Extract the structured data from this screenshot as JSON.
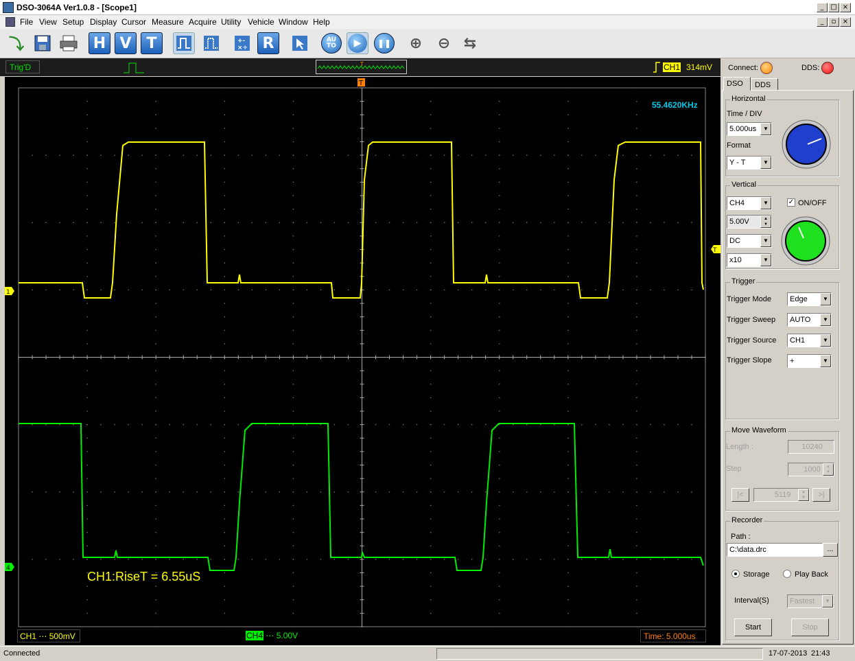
{
  "window": {
    "title": "DSO-3064A Ver1.0.8 - [Scope1]"
  },
  "menu": [
    "File",
    "View",
    "Setup",
    "Display",
    "Cursor",
    "Measure",
    "Acquire",
    "Utility",
    "Vehicle",
    "Window",
    "Help"
  ],
  "toolbar": {
    "h": "H",
    "v": "V",
    "t": "T",
    "r": "R",
    "auto": "AU TO"
  },
  "status": {
    "trig": "Trig'D",
    "trig_ch": "CH1",
    "trig_level": "314mV"
  },
  "scope": {
    "frequency": "55.4620KHz",
    "measurement": "CH1:RiseT = 6.55uS",
    "ch1_label": "CH1",
    "ch1_scale": "500mV",
    "ch4_label": "CH4",
    "ch4_scale": "5.00V",
    "time": "Time: 5.000us",
    "trigger_marker": "T",
    "ch1_marker": "1",
    "ch4_marker": "4",
    "ch1_color": "#ffff00",
    "ch4_color": "#00ee00"
  },
  "panel": {
    "connect": "Connect:",
    "dds": "DDS:",
    "tabs": [
      "DSO",
      "DDS"
    ],
    "horizontal": {
      "title": "Horizontal",
      "time_div_label": "Time / DIV",
      "time_div": "5.000us",
      "format_label": "Format",
      "format": "Y - T"
    },
    "vertical": {
      "title": "Vertical",
      "channel": "CH4",
      "onoff": "ON/OFF",
      "volts": "5.00V",
      "coupling": "DC",
      "probe": "x10"
    },
    "trigger": {
      "title": "Trigger",
      "mode_label": "Trigger Mode",
      "mode": "Edge",
      "sweep_label": "Trigger Sweep",
      "sweep": "AUTO",
      "source_label": "Trigger Source",
      "source": "CH1",
      "slope_label": "Trigger Slope",
      "slope": "+"
    },
    "move": {
      "title": "Move Waveform",
      "length_label": "Length :",
      "length": "10240",
      "step_label": "Step",
      "step": "1000",
      "position": "5119",
      "first": "|<",
      "last": ">|"
    },
    "recorder": {
      "title": "Recorder",
      "path_label": "Path :",
      "path": "C:\\data.drc",
      "browse": "...",
      "storage": "Storage",
      "playback": "Play Back",
      "interval_label": "Interval(S)",
      "interval": "Fastest",
      "start": "Start",
      "stop": "Stop"
    }
  },
  "statusbar": {
    "left": "Connected",
    "date": "17-07-2013",
    "time": "21:43"
  },
  "colors": {
    "connect_led": "#ff8c00",
    "dds_led": "#ee1111"
  }
}
